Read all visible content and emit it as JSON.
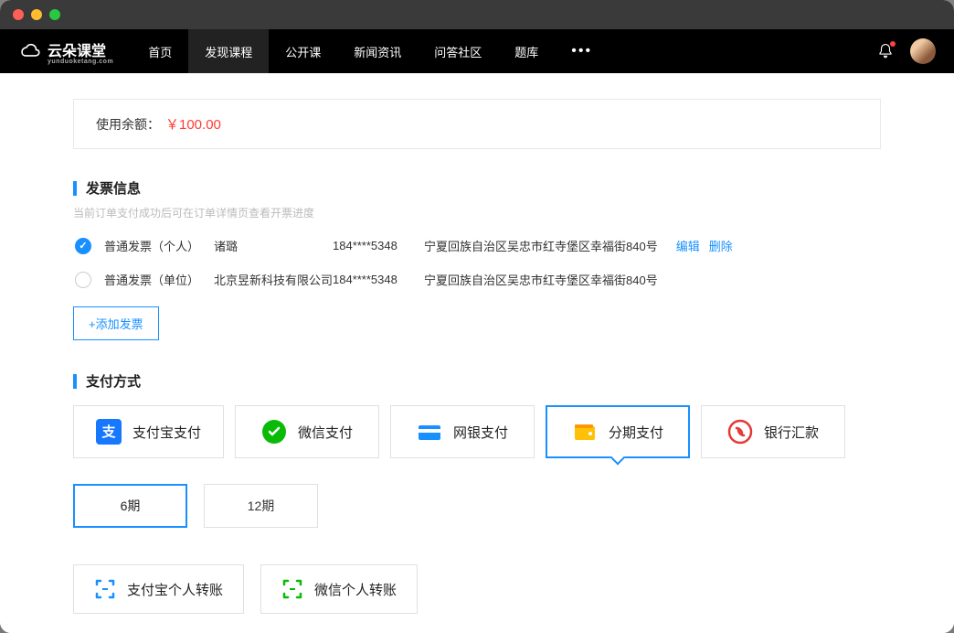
{
  "logo": {
    "text": "云朵课堂",
    "subtext": "yunduoketang.com"
  },
  "nav": {
    "items": [
      "首页",
      "发现课程",
      "公开课",
      "新闻资讯",
      "问答社区",
      "题库"
    ],
    "activeIndex": 1
  },
  "balance": {
    "label": "使用余额：",
    "amount": "￥100.00"
  },
  "invoice": {
    "title": "发票信息",
    "subtitle": "当前订单支付成功后可在订单详情页查看开票进度",
    "rows": [
      {
        "type": "普通发票（个人）",
        "name": "诸璐",
        "phone": "184****5348",
        "address": "宁夏回族自治区吴忠市红寺堡区幸福街840号",
        "selected": true,
        "editLabel": "编辑",
        "deleteLabel": "删除"
      },
      {
        "type": "普通发票（单位）",
        "name": "北京昱新科技有限公司",
        "phone": "184****5348",
        "address": "宁夏回族自治区吴忠市红寺堡区幸福街840号",
        "selected": false
      }
    ],
    "addLabel": "+添加发票"
  },
  "payment": {
    "title": "支付方式",
    "methods": [
      {
        "icon": "alipay",
        "label": "支付宝支付"
      },
      {
        "icon": "wechat",
        "label": "微信支付"
      },
      {
        "icon": "bank",
        "label": "网银支付"
      },
      {
        "icon": "installment",
        "label": "分期支付",
        "selected": true
      },
      {
        "icon": "banktransfer",
        "label": "银行汇款"
      }
    ],
    "installments": [
      {
        "label": "6期",
        "selected": true
      },
      {
        "label": "12期",
        "selected": false
      }
    ],
    "transfers": [
      {
        "icon": "alipay-transfer",
        "label": "支付宝个人转账"
      },
      {
        "icon": "wechat-transfer",
        "label": "微信个人转账"
      }
    ]
  }
}
